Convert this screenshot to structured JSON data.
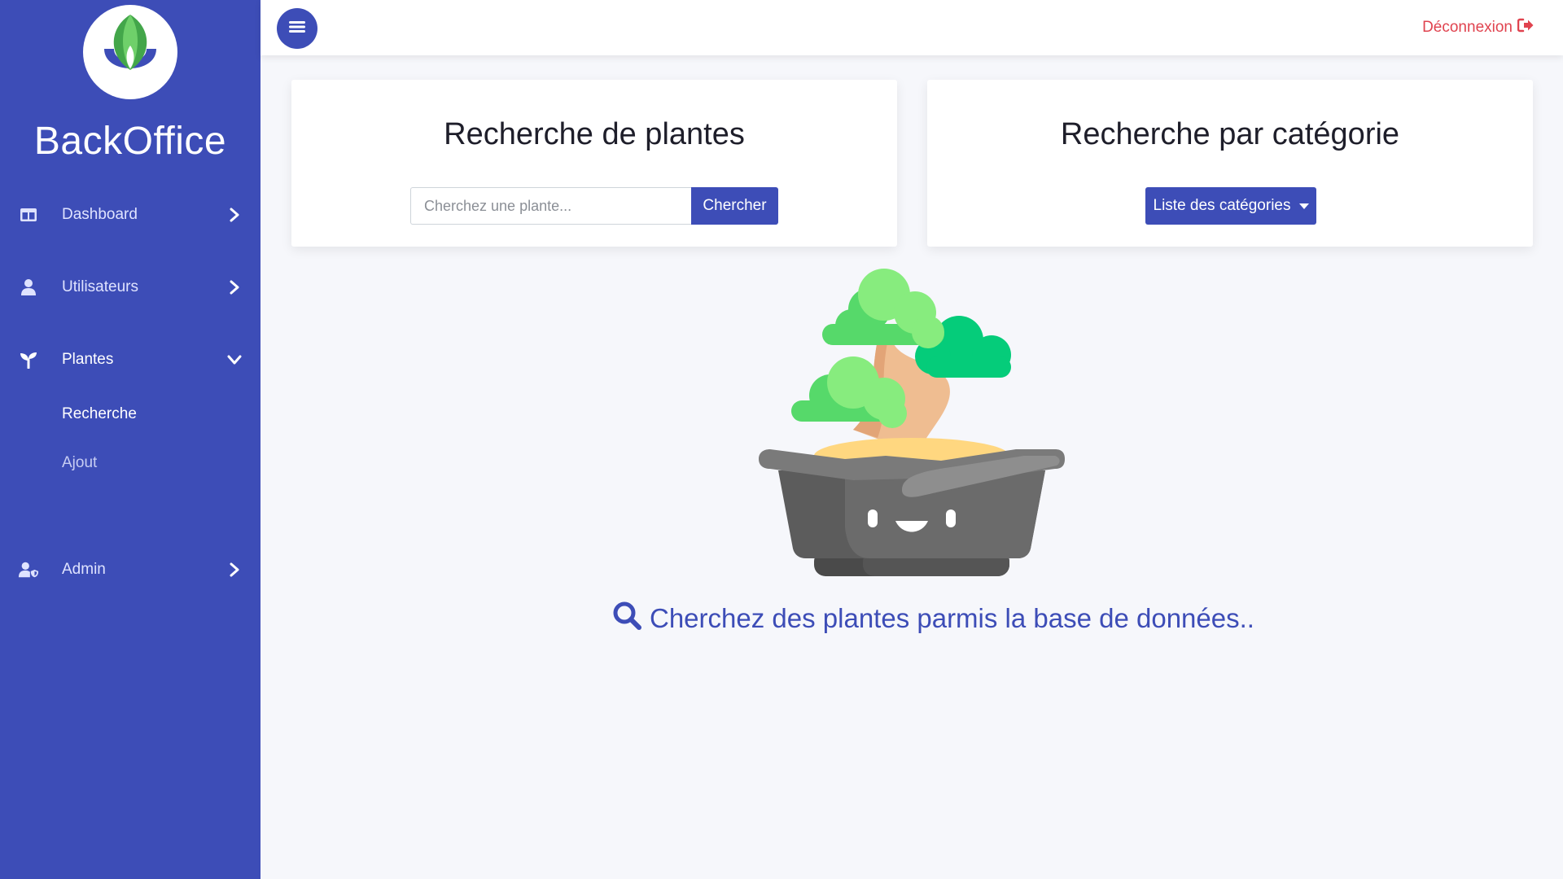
{
  "sidebar": {
    "brand": "BackOffice",
    "items": [
      {
        "label": "Dashboard",
        "icon": "table-icon"
      },
      {
        "label": "Utilisateurs",
        "icon": "user-icon"
      },
      {
        "label": "Plantes",
        "icon": "seedling-icon",
        "expanded": true,
        "children": [
          {
            "label": "Recherche",
            "active": true
          },
          {
            "label": "Ajout",
            "active": false
          }
        ]
      },
      {
        "label": "Admin",
        "icon": "user-shield-icon"
      }
    ]
  },
  "topbar": {
    "menu_icon": "hamburger-icon",
    "logout_label": "Déconnexion",
    "logout_icon": "sign-out-icon"
  },
  "search_card": {
    "title": "Recherche de plantes",
    "placeholder": "Cherchez une plante...",
    "button_label": "Chercher"
  },
  "category_card": {
    "title": "Recherche par catégorie",
    "dropdown_label": "Liste des catégories"
  },
  "empty_state": {
    "illustration": "bonsai-pot-illustration",
    "message": "Cherchez des plantes parmis la base de données.."
  },
  "colors": {
    "primary": "#3d4db7",
    "danger": "#e0434f",
    "background": "#f6f7fb"
  }
}
